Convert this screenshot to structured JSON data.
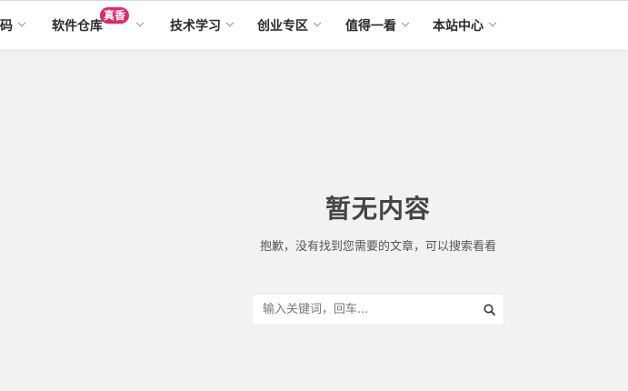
{
  "nav": {
    "items": [
      {
        "label": "码"
      },
      {
        "label": "软件仓库",
        "badge": "真香"
      },
      {
        "label": "技术学习"
      },
      {
        "label": "创业专区"
      },
      {
        "label": "值得一看"
      },
      {
        "label": "本站中心"
      }
    ]
  },
  "empty": {
    "title": "暂无内容",
    "subtitle": "抱歉，没有找到您需要的文章，可以搜索看看"
  },
  "search": {
    "placeholder": "输入关键词，回车...",
    "icon": "search-icon"
  },
  "colors": {
    "background": "#f2f2f2",
    "badge": "#e8236d",
    "nav_text": "#2b2b2b"
  }
}
